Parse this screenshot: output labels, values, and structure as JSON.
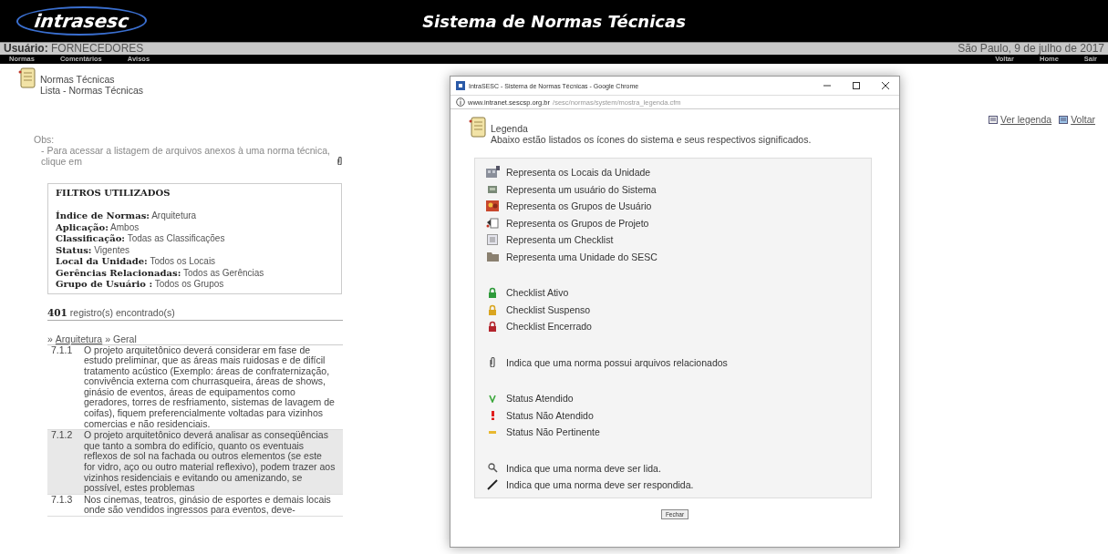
{
  "header": {
    "logo": "intrasesc",
    "title": "Sistema de Normas Técnicas"
  },
  "user_bar": {
    "label": "Usuário:",
    "value": "FORNECEDORES",
    "date": "São Paulo, 9 de julho de 2017"
  },
  "nav_left": [
    "Normas",
    "Comentários",
    "Avisos"
  ],
  "nav_right": [
    "Voltar",
    "Home",
    "Sair"
  ],
  "page": {
    "title": "Normas Técnicas",
    "subtitle": "Lista - Normas Técnicas"
  },
  "links": [
    "Ver legenda",
    "Voltar"
  ],
  "obs": {
    "label": "Obs:",
    "text": "- Para acessar a listagem de arquivos anexos à uma norma técnica, clique em"
  },
  "filters": {
    "title": "FILTROS UTILIZADOS",
    "items": [
      {
        "label": "Índice de Normas:",
        "value": "Arquitetura"
      },
      {
        "label": "Aplicação:",
        "value": "Ambos"
      },
      {
        "label": "Classificação:",
        "value": "Todas as Classificações"
      },
      {
        "label": "Status:",
        "value": "Vigentes"
      },
      {
        "label": "Local da Unidade:",
        "value": "Todos os Locais"
      },
      {
        "label": "Gerências Relacionadas:",
        "value": "Todos as Gerências"
      },
      {
        "label": "Grupo de Usuário :",
        "value": "Todos os Grupos"
      }
    ]
  },
  "count": {
    "number": "401",
    "text": "registro(s) encontrado(s)"
  },
  "breadcrumb": {
    "prefix": "»",
    "link": "Arquitetura",
    "separator": "»",
    "current": "Geral"
  },
  "rows": [
    {
      "code": "7.1.1",
      "text": "O projeto arquitetônico deverá considerar em fase de estudo preliminar, que as áreas mais ruidosas e de difícil tratamento acústico (Exemplo: áreas de confraternização, convivência externa com churrasqueira, áreas de shows, ginásio de eventos, áreas de equipamentos como geradores, torres de resfriamento, sistemas de lavagem de coifas), fiquem preferencialmente voltadas para vizinhos comercias e não residenciais.",
      "highlighted": false
    },
    {
      "code": "7.1.2",
      "text": "O projeto arquitetônico deverá analisar as conseqüências que tanto a sombra do edifício, quanto os eventuais reflexos de sol na fachada ou outros elementos (se este for vidro, aço ou outro material reflexivo), podem trazer aos vizinhos residenciais e evitando ou amenizando, se possível, estes problemas",
      "highlighted": true
    },
    {
      "code": "7.1.3",
      "text": "Nos cinemas, teatros, ginásio de esportes e demais locais onde são vendidos ingressos para eventos, deve-",
      "highlighted": false
    }
  ],
  "popup": {
    "window_title": "IntraSESC - Sistema de Normas Técnicas - Google Chrome",
    "url_host": "www.intranet.sescsp.org.br",
    "url_path": "/sesc/normas/system/mostra_legenda.cfm",
    "heading": "Legenda",
    "intro": "Abaixo estão listados os ícones do sistema e seus respectivos significados.",
    "groups": [
      [
        {
          "kind": "locais",
          "text": "Representa os Locais da Unidade"
        },
        {
          "kind": "usuario",
          "text": "Representa um usuário do Sistema"
        },
        {
          "kind": "grupo-usuario",
          "text": "Representa os Grupos de Usuário"
        },
        {
          "kind": "grupo-projeto",
          "text": "Representa os Grupos de Projeto"
        },
        {
          "kind": "checklist",
          "text": "Representa um Checklist"
        },
        {
          "kind": "unidade",
          "text": "Representa uma Unidade do SESC"
        }
      ],
      [
        {
          "kind": "lock",
          "color": "#2e9a3a",
          "text": "Checklist Ativo"
        },
        {
          "kind": "lock",
          "color": "#d9a520",
          "text": "Checklist Suspenso"
        },
        {
          "kind": "lock",
          "color": "#b3242c",
          "text": "Checklist Encerrado"
        }
      ],
      [
        {
          "kind": "clip",
          "text": "Indica que uma norma possui arquivos relacionados"
        }
      ],
      [
        {
          "kind": "check",
          "color": "#3aa63a",
          "text": "Status Atendido"
        },
        {
          "kind": "exclaim",
          "color": "#e02020",
          "text": "Status Não Atendido"
        },
        {
          "kind": "dash",
          "color": "#e8b830",
          "text": "Status Não Pertinente"
        }
      ],
      [
        {
          "kind": "search",
          "text": "Indica que uma norma deve ser lida."
        },
        {
          "kind": "pencil",
          "text": "Indica que uma norma deve ser respondida."
        }
      ]
    ],
    "close_button": "Fechar"
  }
}
